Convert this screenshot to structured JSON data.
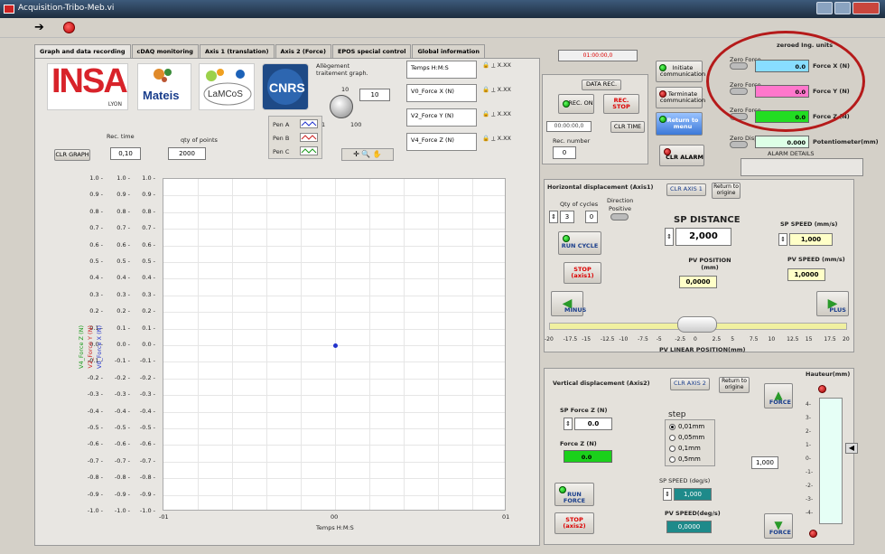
{
  "window": {
    "title": "Acquisition-Tribo-Meb.vi"
  },
  "toolbar": {
    "run_icon": "run-arrow-icon",
    "stop_icon": "abort-stop-icon"
  },
  "tabs": [
    "Graph and data recording",
    "cDAQ monitoring",
    "Axis 1 (translation)",
    "Axis 2 (Force)",
    "EPOS special control",
    "Global information"
  ],
  "logos": {
    "insa_big": "INSA",
    "insa_small": "LYON",
    "mateis": "Mateis",
    "lamcos": "LaMCoS",
    "cnrs": "CNRS"
  },
  "recording": {
    "allegement_label": "Allègement traitement graph.",
    "knob_min": "1",
    "knob_max": "100",
    "knob_top": "10",
    "knob_value": "10",
    "rec_time_label": "Rec. time",
    "rec_time_value": "0,10",
    "qty_label": "qty of points",
    "qty_value": "2000",
    "clr_graph": "CLR GRAPH",
    "pens": [
      "Pen A",
      "Pen B",
      "Pen C"
    ],
    "channels": [
      "Temps H:M:S",
      "V0_Force X (N)",
      "V2_Force Y (N)",
      "V4_Force Z (N)"
    ],
    "channel_fmt": "X.XX"
  },
  "graph": {
    "x_label": "Temps H:M:S",
    "x_ticks": [
      "-01",
      "00",
      "01"
    ],
    "y_ticks": [
      "1.0",
      "0.9",
      "0.8",
      "0.7",
      "0.6",
      "0.5",
      "0.4",
      "0.3",
      "0.2",
      "0.1",
      "0.0",
      "-0.1",
      "-0.2",
      "-0.3",
      "-0.4",
      "-0.5",
      "-0.6",
      "-0.7",
      "-0.8",
      "-0.9",
      "-1.0"
    ],
    "axis_names": [
      "V4_Force Z (N)",
      "V2_Force Y (N)",
      "V0_Force X (N)"
    ],
    "axis_colors": [
      "#1a9a1a",
      "#cc2222",
      "#2233cc"
    ],
    "point": {
      "x": 0,
      "y": 0.0
    }
  },
  "time_display": "01:00:00,0",
  "data_rec": {
    "title": "DATA REC.",
    "rec_on": "REC. ON",
    "rec_stop": "REC. STOP",
    "time": "00:00:00,0",
    "clr_time": "CLR TIME",
    "rec_number_label": "Rec. number",
    "rec_number": "0"
  },
  "comm": {
    "initiate": "Initiate communication",
    "terminate": "Terminate communication",
    "return_menu": "Return to menu",
    "clr_alarm": "CLR ALARM"
  },
  "zeroed": {
    "title": "zeroed Ing. units",
    "rows": [
      {
        "btn": "Zero Force",
        "value": "0.0",
        "label": "Force X (N)",
        "color": "#88ddff"
      },
      {
        "btn": "Zero Force",
        "value": "0.0",
        "label": "Force Y (N)",
        "color": "#ff77cc"
      },
      {
        "btn": "Zero Force",
        "value": "0.0",
        "label": "Force Z (N)",
        "color": "#22dd22"
      }
    ],
    "pot_btn": "Zero Displ",
    "pot_value": "0.000",
    "pot_label": "Potentiometer(mm)",
    "alarm_label": "ALARM DETAILS"
  },
  "axis1": {
    "title": "Horizontal displacement (Axis1)",
    "clr": "CLR AXIS 1",
    "return": "Return to origine",
    "qty_cycles_label": "Qty of cycles",
    "qty_cycles": "3",
    "qty_cycles2": "0",
    "direction_label": "Direction",
    "direction_value": "Positive",
    "run_cycle": "RUN CYCLE",
    "sp_distance_label": "SP DISTANCE",
    "sp_distance": "2,000",
    "sp_speed_label": "SP SPEED (mm/s)",
    "sp_speed": "1,000",
    "pv_position_label": "PV POSITION (mm)",
    "pv_position": "0,0000",
    "pv_speed_label": "PV SPEED (mm/s)",
    "pv_speed": "1,0000",
    "stop": "STOP (axis1)",
    "minus": "MINUS",
    "plus": "PLUS",
    "scale": [
      "-20",
      "-17.5",
      "-15",
      "-12.5",
      "-10",
      "-7.5",
      "-5",
      "-2.5",
      "0",
      "2.5",
      "5",
      "7.5",
      "10",
      "12.5",
      "15",
      "17.5",
      "20"
    ],
    "scale_label": "PV LINEAR POSITION(mm)"
  },
  "axis2": {
    "title": "Vertical displacement (Axis2)",
    "clr": "CLR AXIS 2",
    "return": "Return to origine",
    "sp_force_label": "SP Force Z (N)",
    "sp_force": "0.0",
    "force_label": "Force Z (N)",
    "force_value": "0.0",
    "step_label": "step",
    "steps": [
      "0,01mm",
      "0,05mm",
      "0,1mm",
      "0,5mm"
    ],
    "selected_step": 0,
    "sp_speed_label": "SP SPEED (deg/s)",
    "sp_speed": "1,000",
    "pv_speed_label": "PV SPEED(deg/s)",
    "pv_speed": "0,0000",
    "run_force": "RUN FORCE",
    "stop": "STOP (axis2)",
    "force_up": "FORCE",
    "force_down": "FORCE",
    "hauteur_label": "Hauteur(mm)",
    "hauteur_value": "1,000",
    "hauteur_ticks": [
      "4-",
      "3-",
      "2-",
      "1-",
      "0-",
      "-1-",
      "-2-",
      "-3-",
      "-4-"
    ]
  }
}
